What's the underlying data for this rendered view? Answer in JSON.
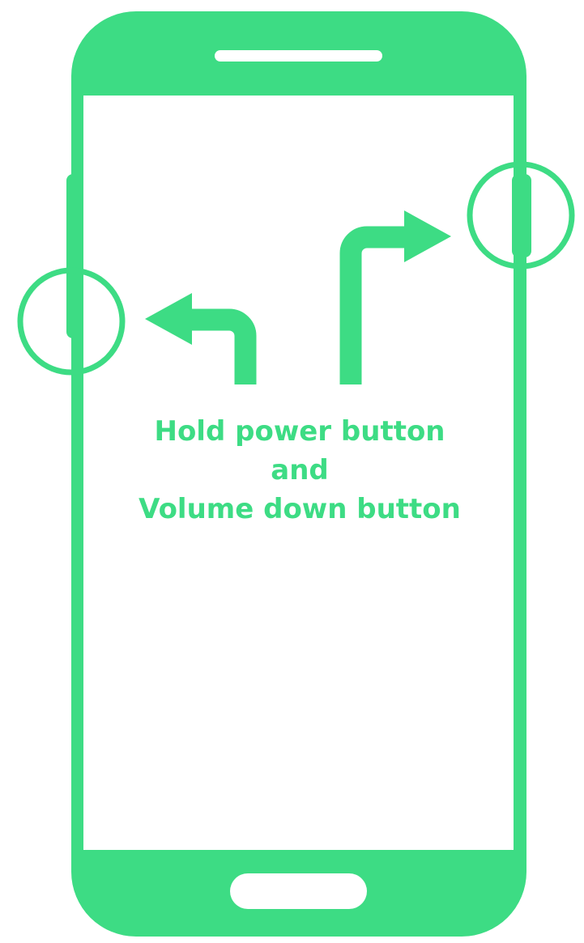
{
  "colors": {
    "accent": "#3ddc84",
    "background": "#ffffff"
  },
  "instruction": {
    "line1": "Hold power button",
    "line2": "and",
    "line3": "Volume down button"
  },
  "icons": {
    "phone": "smartphone-icon",
    "left_arrow": "arrow-turn-left-icon",
    "right_arrow": "arrow-turn-right-icon",
    "left_highlight": "circle-highlight-icon",
    "right_highlight": "circle-highlight-icon"
  }
}
